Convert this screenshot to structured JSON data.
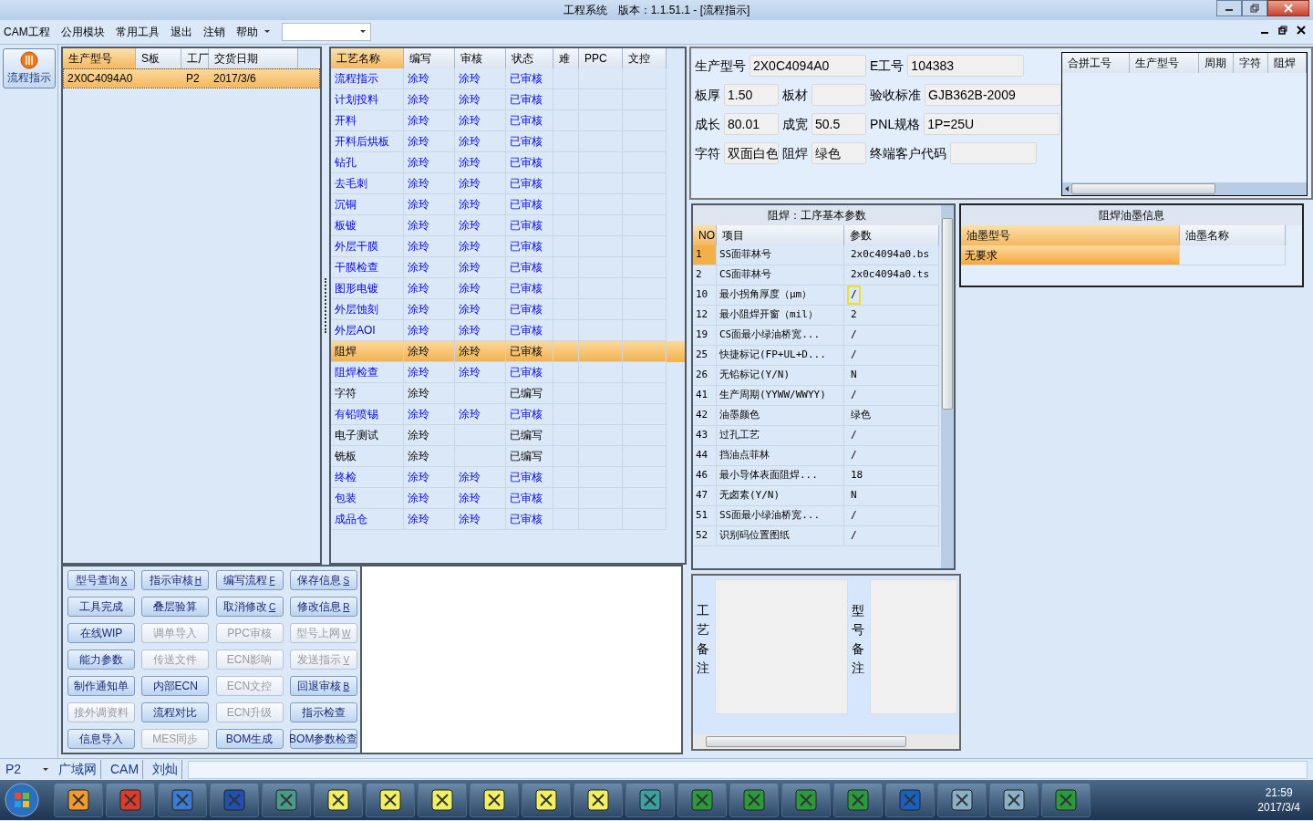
{
  "window": {
    "title": "工程系统　版本：1.1.51.1 - [流程指示]"
  },
  "menu": [
    {
      "label": "CAM工程"
    },
    {
      "label": "公用模块"
    },
    {
      "label": "常用工具"
    },
    {
      "label": "退出"
    },
    {
      "label": "注销"
    },
    {
      "label": "帮助"
    }
  ],
  "nav": [
    {
      "label": "流程指示",
      "selected": true
    }
  ],
  "model_table": {
    "columns": [
      "生产型号",
      "S板",
      "工厂",
      "交货日期"
    ],
    "rows": [
      {
        "cells": [
          "2X0C4094A0",
          "",
          "P2",
          "2017/3/6"
        ],
        "selected": true
      }
    ]
  },
  "process_table": {
    "columns": [
      "工艺名称",
      "编写",
      "审核",
      "状态",
      "难",
      "PPC",
      "文控"
    ],
    "rows": [
      {
        "name": "流程指示",
        "writer": "涂玲",
        "reviewer": "涂玲",
        "status": "已审核",
        "kind": "link",
        "selected": false
      },
      {
        "name": "计划投料",
        "writer": "涂玲",
        "reviewer": "涂玲",
        "status": "已审核",
        "kind": "link",
        "selected": false
      },
      {
        "name": "开料",
        "writer": "涂玲",
        "reviewer": "涂玲",
        "status": "已审核",
        "kind": "link",
        "selected": false
      },
      {
        "name": "开料后烘板",
        "writer": "涂玲",
        "reviewer": "涂玲",
        "status": "已审核",
        "kind": "link",
        "selected": false
      },
      {
        "name": "钻孔",
        "writer": "涂玲",
        "reviewer": "涂玲",
        "status": "已审核",
        "kind": "link",
        "selected": false
      },
      {
        "name": "去毛刺",
        "writer": "涂玲",
        "reviewer": "涂玲",
        "status": "已审核",
        "kind": "link",
        "selected": false
      },
      {
        "name": "沉铜",
        "writer": "涂玲",
        "reviewer": "涂玲",
        "status": "已审核",
        "kind": "link",
        "selected": false
      },
      {
        "name": "板镀",
        "writer": "涂玲",
        "reviewer": "涂玲",
        "status": "已审核",
        "kind": "link",
        "selected": false
      },
      {
        "name": "外层干膜",
        "writer": "涂玲",
        "reviewer": "涂玲",
        "status": "已审核",
        "kind": "link",
        "selected": false
      },
      {
        "name": "干膜检查",
        "writer": "涂玲",
        "reviewer": "涂玲",
        "status": "已审核",
        "kind": "link",
        "selected": false
      },
      {
        "name": "图形电镀",
        "writer": "涂玲",
        "reviewer": "涂玲",
        "status": "已审核",
        "kind": "link",
        "selected": false
      },
      {
        "name": "外层蚀刻",
        "writer": "涂玲",
        "reviewer": "涂玲",
        "status": "已审核",
        "kind": "link",
        "selected": false
      },
      {
        "name": "外层AOI",
        "writer": "涂玲",
        "reviewer": "涂玲",
        "status": "已审核",
        "kind": "link",
        "selected": false
      },
      {
        "name": "阻焊",
        "writer": "涂玲",
        "reviewer": "涂玲",
        "status": "已审核",
        "kind": "plain",
        "selected": true
      },
      {
        "name": "阻焊检查",
        "writer": "涂玲",
        "reviewer": "涂玲",
        "status": "已审核",
        "kind": "link",
        "selected": false
      },
      {
        "name": "字符",
        "writer": "涂玲",
        "status": "已编写",
        "kind": "plain",
        "selected": false
      },
      {
        "name": "有铅喷锡",
        "writer": "涂玲",
        "reviewer": "涂玲",
        "status": "已审核",
        "kind": "link",
        "selected": false
      },
      {
        "name": "电子测试",
        "writer": "涂玲",
        "status": "已编写",
        "kind": "plain",
        "selected": false
      },
      {
        "name": "铣板",
        "writer": "涂玲",
        "status": "已编写",
        "kind": "plain",
        "selected": false
      },
      {
        "name": "终检",
        "writer": "涂玲",
        "reviewer": "涂玲",
        "status": "已审核",
        "kind": "link",
        "selected": false
      },
      {
        "name": "包装",
        "writer": "涂玲",
        "reviewer": "涂玲",
        "status": "已审核",
        "kind": "link",
        "selected": false
      },
      {
        "name": "成品仓",
        "writer": "涂玲",
        "reviewer": "涂玲",
        "status": "已审核",
        "kind": "link",
        "selected": false
      }
    ]
  },
  "buttons": [
    {
      "label": "型号查询",
      "shortcut": "X",
      "disabled": false
    },
    {
      "label": "指示审核",
      "shortcut": "H",
      "disabled": false
    },
    {
      "label": "编写流程",
      "shortcut": "F",
      "disabled": false
    },
    {
      "label": "保存信息",
      "shortcut": "S",
      "disabled": false
    },
    {
      "label": "工具完成",
      "disabled": false
    },
    {
      "label": "叠层验算",
      "disabled": false
    },
    {
      "label": "取消修改",
      "shortcut": "C",
      "disabled": false
    },
    {
      "label": "修改信息",
      "shortcut": "R",
      "disabled": false
    },
    {
      "label": "在线WIP",
      "disabled": false
    },
    {
      "label": "调单导入",
      "disabled": true
    },
    {
      "label": "PPC审核",
      "disabled": true
    },
    {
      "label": "型号上网",
      "shortcut": "W",
      "disabled": true
    },
    {
      "label": "能力参数",
      "disabled": false
    },
    {
      "label": "传送文件",
      "disabled": true
    },
    {
      "label": "ECN影响",
      "disabled": true
    },
    {
      "label": "发送指示",
      "shortcut": "V",
      "disabled": true
    },
    {
      "label": "制作通知单",
      "disabled": false
    },
    {
      "label": "内部ECN",
      "disabled": false
    },
    {
      "label": "ECN文控",
      "disabled": true
    },
    {
      "label": "回退审核",
      "shortcut": "B",
      "disabled": false
    },
    {
      "label": "接外调资料",
      "disabled": true
    },
    {
      "label": "流程对比",
      "disabled": false
    },
    {
      "label": "ECN升级",
      "disabled": true
    },
    {
      "label": "指示检查",
      "disabled": false
    },
    {
      "label": "信息导入",
      "disabled": false
    },
    {
      "label": "MES同步",
      "disabled": true
    },
    {
      "label": "BOM生成",
      "disabled": false
    },
    {
      "label": "BOM参数检查",
      "disabled": false
    }
  ],
  "info": {
    "fields": [
      {
        "label": "生产型号",
        "value": "2X0C4094A0"
      },
      {
        "label": "E工号",
        "value": "104383"
      },
      {
        "label": "板厚",
        "value": "1.50"
      },
      {
        "label": "板材"
      },
      {
        "label": "验收标准",
        "value": "GJB362B-2009"
      },
      {
        "label": "成长",
        "value": "80.01"
      },
      {
        "label": "成宽",
        "value": "50.5"
      },
      {
        "label": "PNL规格",
        "value": "1P=25U"
      },
      {
        "label": "字符",
        "value": "双面白色"
      },
      {
        "label": "阻焊",
        "value": "绿色"
      },
      {
        "label": "终端客户代码"
      }
    ]
  },
  "combine_table": {
    "columns": [
      "合拼工号",
      "生产型号",
      "周期",
      "字符",
      "阻焊"
    ]
  },
  "param_table": {
    "title": "阻焊：工序基本参数",
    "columns": [
      "NO",
      "项目",
      "参数"
    ],
    "rows": [
      {
        "no": "1",
        "item": "SS面菲林号",
        "value": "2x0c4094a0.bs",
        "selected": true,
        "focused": false
      },
      {
        "no": "2",
        "item": "CS面菲林号",
        "value": "2x0c4094a0.ts",
        "selected": false,
        "focused": false
      },
      {
        "no": "10",
        "item": "最小拐角厚度（μm）",
        "value": "/",
        "selected": false,
        "focused": true
      },
      {
        "no": "12",
        "item": "最小阻焊开窗（mil）",
        "value": "2",
        "selected": false,
        "focused": false
      },
      {
        "no": "19",
        "item": "CS面最小绿油桥宽...",
        "value": "/",
        "selected": false,
        "focused": false
      },
      {
        "no": "25",
        "item": "快捷标记(FP+UL+D...",
        "value": "/",
        "selected": false,
        "focused": false
      },
      {
        "no": "26",
        "item": "无铅标记(Y/N)",
        "value": "N",
        "selected": false,
        "focused": false
      },
      {
        "no": "41",
        "item": "生产周期(YYWW/WWYY)",
        "value": "/",
        "selected": false,
        "focused": false
      },
      {
        "no": "42",
        "item": "油墨颜色",
        "value": "绿色",
        "selected": false,
        "focused": false
      },
      {
        "no": "43",
        "item": "过孔工艺",
        "value": "/",
        "selected": false,
        "focused": false
      },
      {
        "no": "44",
        "item": "挡油点菲林",
        "value": "/",
        "selected": false,
        "focused": false
      },
      {
        "no": "46",
        "item": "最小导体表面阻焊...",
        "value": "18",
        "selected": false,
        "focused": false
      },
      {
        "no": "47",
        "item": "无卤素(Y/N)",
        "value": "N",
        "selected": false,
        "focused": false
      },
      {
        "no": "51",
        "item": "SS面最小绿油桥宽...",
        "value": "/",
        "selected": false,
        "focused": false
      },
      {
        "no": "52",
        "item": "识别码位置图纸",
        "value": "/",
        "selected": false,
        "focused": false
      }
    ]
  },
  "ink_table": {
    "title": "阻焊油墨信息",
    "columns": [
      "油墨型号",
      "油墨名称"
    ],
    "rows": [
      {
        "cells": [
          "无要求",
          ""
        ],
        "selected": true
      }
    ]
  },
  "remarks": [
    {
      "label": "工艺备注"
    },
    {
      "label": "型号备注"
    }
  ],
  "status_bar": {
    "factory": "P2",
    "items": [
      "广域网",
      "CAM",
      "刘灿"
    ]
  },
  "taskbar": {
    "time": "21:59",
    "date": "2017/3/4"
  }
}
